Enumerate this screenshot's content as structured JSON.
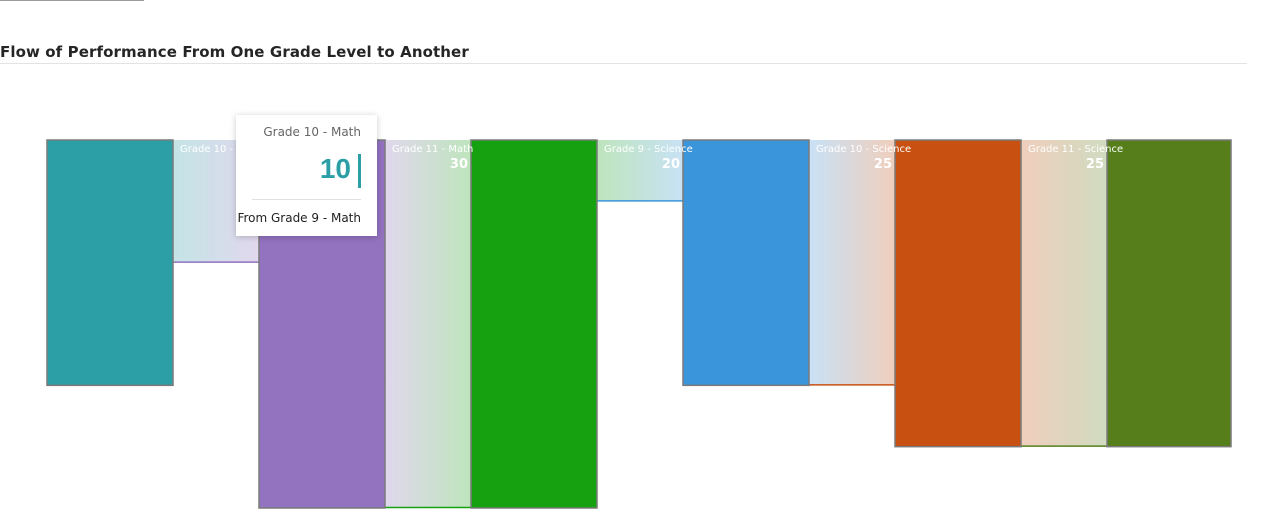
{
  "title": "Flow of Performance From One Grade Level to Another",
  "tooltip": {
    "title": "Grade 10 - Math",
    "value": "10",
    "subtitle": "From Grade 9 - Math"
  },
  "chart_data": {
    "type": "sankey",
    "title": "Flow of Performance From One Grade Level to Another",
    "nodes": [
      {
        "name": "Grade 9 - Math",
        "value": 20,
        "color": "#2b9ea6"
      },
      {
        "name": "Grade 10 - Math",
        "value": 30,
        "color": "#9372bf"
      },
      {
        "name": "Grade 11 - Math",
        "value": 30,
        "color": "#16a111"
      },
      {
        "name": "Grade 9 - Science",
        "value": 20,
        "color": "#3b95db"
      },
      {
        "name": "Grade 10 - Science",
        "value": 25,
        "color": "#c85011"
      },
      {
        "name": "Grade 11 - Science",
        "value": 25,
        "color": "#567f1c"
      }
    ],
    "links": [
      {
        "source": "Grade 9 - Math",
        "target": "Grade 10 - Math",
        "value": 10,
        "label": "Grade 10 - Math"
      },
      {
        "source": "Grade 10 - Math",
        "target": "Grade 11 - Math",
        "value": 30,
        "label": "Grade 11 - Math"
      },
      {
        "source": "Grade 11 - Math",
        "target": "Grade 9 - Science",
        "value": 5,
        "label": "Grade 9 - Science"
      },
      {
        "source": "Grade 9 - Science",
        "target": "Grade 10 - Science",
        "value": 20,
        "label": "Grade 10 - Science"
      },
      {
        "source": "Grade 10 - Science",
        "target": "Grade 11 - Science",
        "value": 25,
        "label": "Grade 11 - Science"
      }
    ],
    "link_values_labels": [
      "0",
      "30",
      "20",
      "25",
      "25"
    ],
    "cut_label": "h"
  }
}
